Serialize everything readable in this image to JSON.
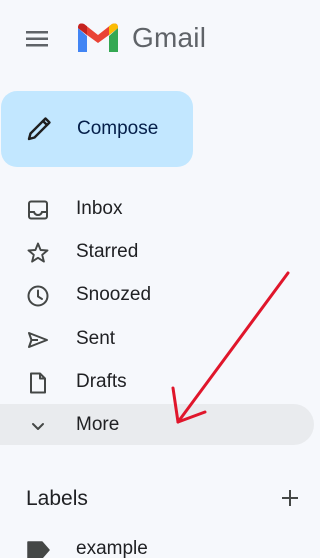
{
  "app": {
    "brand_name": "Gmail",
    "accent_color": "#c2e7ff",
    "icons": {
      "menu": "hamburger-menu-icon",
      "logo": "gmail-logo-icon",
      "compose": "pencil-icon",
      "labels_add": "plus-icon"
    }
  },
  "compose": {
    "label": "Compose"
  },
  "nav": {
    "items": [
      {
        "label": "Inbox",
        "icon": "inbox-icon"
      },
      {
        "label": "Starred",
        "icon": "star-icon"
      },
      {
        "label": "Snoozed",
        "icon": "clock-icon"
      },
      {
        "label": "Sent",
        "icon": "send-icon"
      },
      {
        "label": "Drafts",
        "icon": "draft-icon"
      },
      {
        "label": "More",
        "icon": "chevron-down-icon",
        "highlighted": true
      }
    ]
  },
  "labels": {
    "title": "Labels",
    "items": [
      {
        "label": "example",
        "icon": "label-tag-icon"
      }
    ]
  },
  "annotation": {
    "color": "#e0162b",
    "icon": "red-arrow-annotation"
  }
}
